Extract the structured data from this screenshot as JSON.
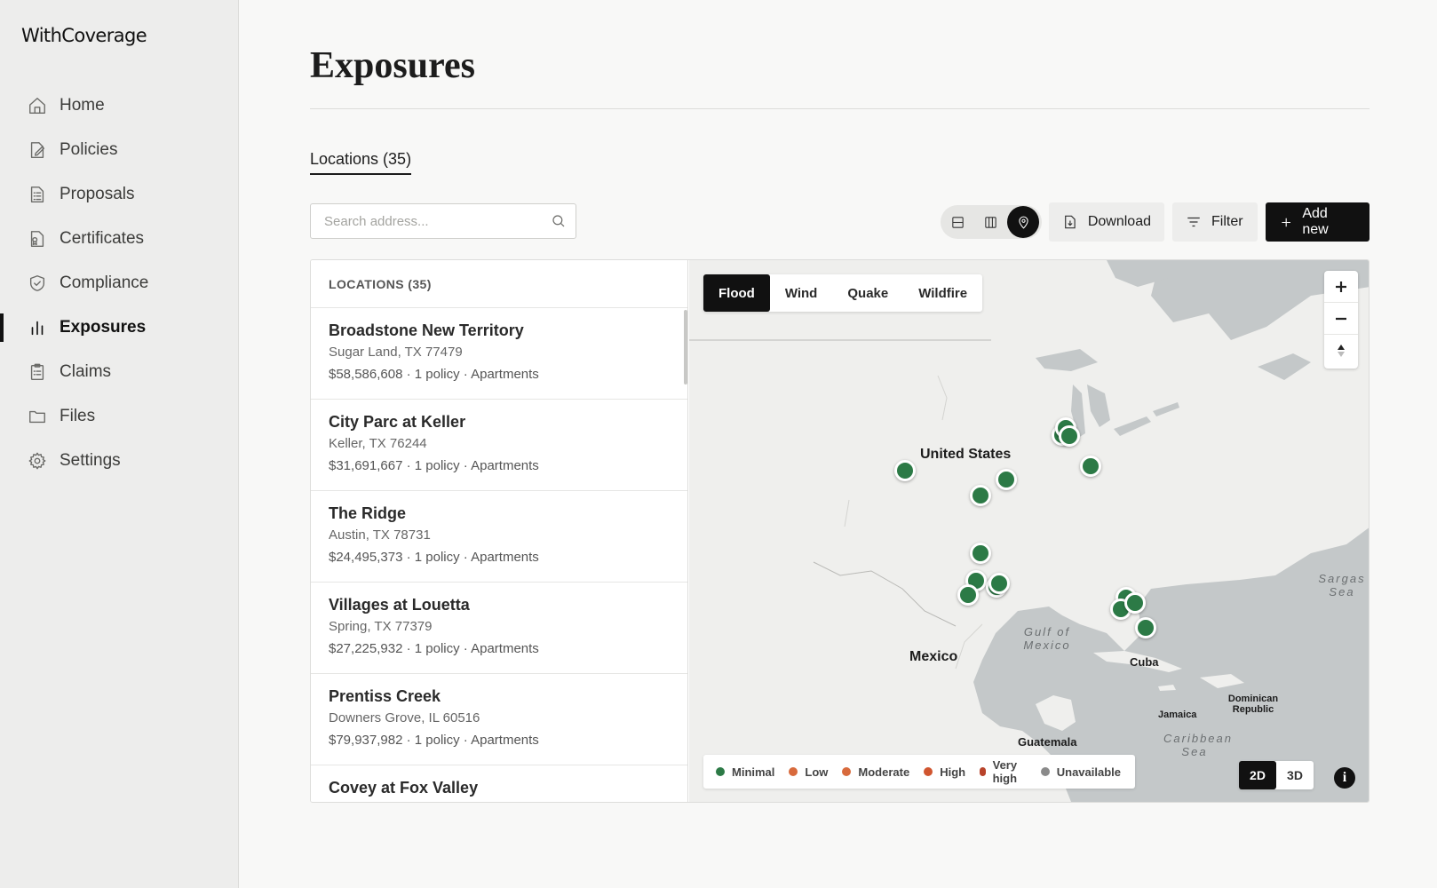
{
  "app": {
    "logo": "WithCoverage"
  },
  "sidebar": {
    "items": [
      {
        "label": "Home",
        "icon": "home-icon"
      },
      {
        "label": "Policies",
        "icon": "document-edit-icon"
      },
      {
        "label": "Proposals",
        "icon": "list-document-icon"
      },
      {
        "label": "Certificates",
        "icon": "certificate-icon"
      },
      {
        "label": "Compliance",
        "icon": "shield-check-icon"
      },
      {
        "label": "Exposures",
        "icon": "bar-chart-icon",
        "active": true
      },
      {
        "label": "Claims",
        "icon": "clipboard-icon"
      },
      {
        "label": "Files",
        "icon": "folder-icon"
      },
      {
        "label": "Settings",
        "icon": "gear-icon"
      }
    ]
  },
  "main": {
    "title": "Exposures",
    "tab_label": "Locations (35)",
    "search_placeholder": "Search address...",
    "toolbar": {
      "download_label": "Download",
      "filter_label": "Filter",
      "add_label": "Add new",
      "active_view": "map-view"
    }
  },
  "list": {
    "header": "LOCATIONS (35)",
    "items": [
      {
        "name": "Broadstone New Territory",
        "address": "Sugar Land, TX 77479",
        "meta": "$58,586,608 · 1 policy · Apartments"
      },
      {
        "name": "City Parc at Keller",
        "address": "Keller, TX 76244",
        "meta": "$31,691,667 · 1 policy · Apartments"
      },
      {
        "name": "The Ridge",
        "address": "Austin, TX 78731",
        "meta": "$24,495,373 · 1 policy · Apartments"
      },
      {
        "name": "Villages at Louetta",
        "address": "Spring, TX 77379",
        "meta": "$27,225,932 · 1 policy · Apartments"
      },
      {
        "name": "Prentiss Creek",
        "address": "Downers Grove, IL 60516",
        "meta": "$79,937,982 · 1 policy · Apartments"
      },
      {
        "name": "Covey at Fox Valley",
        "address": "",
        "meta": ""
      }
    ]
  },
  "map": {
    "hazard_tabs": [
      "Flood",
      "Wind",
      "Quake",
      "Wildfire"
    ],
    "active_hazard": "Flood",
    "labels": {
      "us": "United States",
      "mexico": "Mexico",
      "cuba": "Cuba",
      "gulf": "Gulf of Mexico",
      "jamaica": "Jamaica",
      "dominican": "Dominican Republic",
      "guatemala": "Guatemala",
      "caribbean": "Caribbean Sea",
      "sargasso": "Sargas Sea"
    },
    "legend": [
      {
        "label": "Minimal",
        "color": "#2c7a46"
      },
      {
        "label": "Low",
        "color": "#d86a3c"
      },
      {
        "label": "Moderate",
        "color": "#d86a3c"
      },
      {
        "label": "High",
        "color": "#d0552f"
      },
      {
        "label": "Very high",
        "color": "#b8432b"
      },
      {
        "label": "Unavailable",
        "color": "#8a8a8a"
      }
    ],
    "view_modes": [
      "2D",
      "3D"
    ],
    "active_view_mode": "2D",
    "info_label": "i",
    "marker_color": "#2c7a46"
  }
}
